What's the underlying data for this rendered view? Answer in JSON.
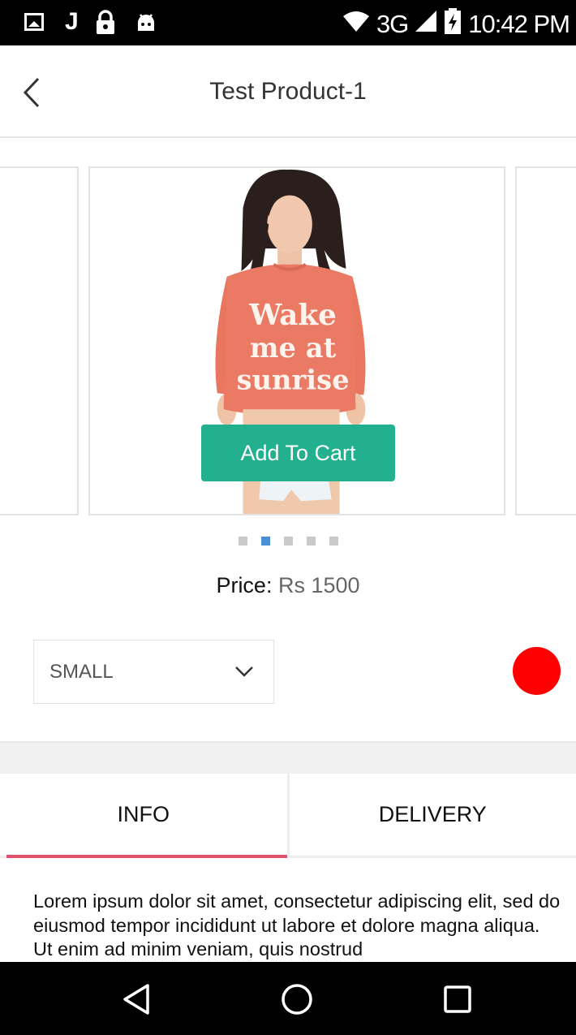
{
  "status_bar": {
    "network": "3G",
    "time": "10:42 PM",
    "left_icons": [
      "image-icon",
      "j-icon",
      "lock-icon",
      "android-icon"
    ],
    "right_icons": [
      "wifi-icon",
      "signal-icon",
      "battery-charging-icon"
    ]
  },
  "header": {
    "title": "Test Product-1",
    "back_icon": "chevron-left-icon"
  },
  "carousel": {
    "add_to_cart_label": "Add To Cart",
    "graphic_text": [
      "Wake",
      "me at",
      "sunrise"
    ],
    "dot_count": 5,
    "active_dot": 1,
    "accent_color": "#23b08f"
  },
  "price": {
    "label": "Price:",
    "value": "Rs 1500"
  },
  "options": {
    "size_selected": "SMALL",
    "color_selected": "#ff0000"
  },
  "tabs": [
    {
      "label": "INFO",
      "active": true
    },
    {
      "label": "DELIVERY",
      "active": false
    }
  ],
  "tab_indicator_color": "#e2506a",
  "info_text": "Lorem ipsum dolor sit amet, consectetur adipiscing elit, sed do eiusmod tempor incididunt ut labore et dolore magna aliqua. Ut enim ad minim veniam, quis nostrud",
  "nav_bar": {
    "buttons": [
      "back-triangle-icon",
      "home-circle-icon",
      "recents-square-icon"
    ]
  }
}
